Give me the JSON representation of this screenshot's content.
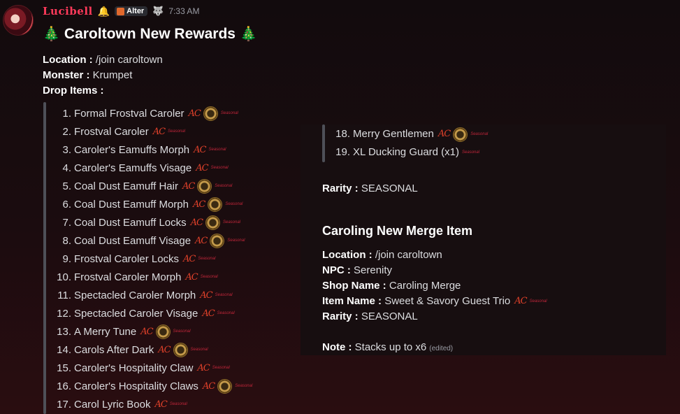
{
  "message": {
    "username": "Lucibell",
    "tag_label": "Alter",
    "timestamp": "7:33 AM",
    "title": "Caroltown New Rewards",
    "fields": [
      {
        "label": "Location :",
        "value": " /join caroltown"
      },
      {
        "label": "Monster :",
        "value": " Krumpet"
      },
      {
        "label": "Drop Items :",
        "value": ""
      }
    ],
    "drop_items": [
      {
        "num": "1.",
        "name": "Formal Frostval Caroler",
        "ac": "AC",
        "coin": true,
        "badge": "Seasonal"
      },
      {
        "num": "2.",
        "name": "Frostval Caroler",
        "ac": "AC",
        "coin": false,
        "badge": "Seasonal"
      },
      {
        "num": "3.",
        "name": "Caroler's Eamuffs Morph",
        "ac": "AC",
        "coin": false,
        "badge": "Seasonal"
      },
      {
        "num": "4.",
        "name": "Caroler's Eamuffs Visage",
        "ac": "AC",
        "coin": false,
        "badge": "Seasonal"
      },
      {
        "num": "5.",
        "name": "Coal Dust Eamuff Hair",
        "ac": "AC",
        "coin": true,
        "badge": "Seasonal"
      },
      {
        "num": "6.",
        "name": "Coal Dust Eamuff Morph",
        "ac": "AC",
        "coin": true,
        "badge": "Seasonal"
      },
      {
        "num": "7.",
        "name": "Coal Dust Eamuff Locks",
        "ac": "AC",
        "coin": true,
        "badge": "Seasonal"
      },
      {
        "num": "8.",
        "name": "Coal Dust Eamuff Visage",
        "ac": "AC",
        "coin": true,
        "badge": "Seasonal"
      },
      {
        "num": "9.",
        "name": "Frostval Caroler Locks",
        "ac": "AC",
        "coin": false,
        "badge": "Seasonal"
      },
      {
        "num": "10.",
        "name": "Frostval Caroler Morph",
        "ac": "AC",
        "coin": false,
        "badge": "Seasonal"
      },
      {
        "num": "11.",
        "name": "Spectacled Caroler Morph",
        "ac": "AC",
        "coin": false,
        "badge": "Seasonal"
      },
      {
        "num": "12.",
        "name": "Spectacled Caroler Visage",
        "ac": "AC",
        "coin": false,
        "badge": "Seasonal"
      },
      {
        "num": "13.",
        "name": "A Merry Tune",
        "ac": "AC",
        "coin": true,
        "badge": "Seasonal"
      },
      {
        "num": "14.",
        "name": "Carols After Dark",
        "ac": "AC",
        "coin": true,
        "badge": "Seasonal"
      },
      {
        "num": "15.",
        "name": "Caroler's Hospitality Claw",
        "ac": "AC",
        "coin": false,
        "badge": "Seasonal"
      },
      {
        "num": "16.",
        "name": "Caroler's Hospitality Claws",
        "ac": "AC",
        "coin": true,
        "badge": "Seasonal"
      },
      {
        "num": "17.",
        "name": "Carol Lyric Book",
        "ac": "AC",
        "coin": false,
        "badge": "Seasonal"
      }
    ]
  },
  "continued": {
    "items": [
      {
        "num": "18.",
        "name": "Merry Gentlemen",
        "ac": "AC",
        "coin": true,
        "badge": "Seasonal"
      },
      {
        "num": "19.",
        "name": "XL Ducking Guard (x1)",
        "ac": "",
        "coin": false,
        "badge": "Seasonal"
      }
    ],
    "rarity_label": "Rarity :",
    "rarity_value": " SEASONAL",
    "merge_title": "Caroling New Merge Item",
    "merge_fields": [
      {
        "label": "Location :",
        "value": " /join caroltown"
      },
      {
        "label": "NPC :",
        "value": " Serenity"
      },
      {
        "label": "Shop Name :",
        "value": " Caroling Merge"
      },
      {
        "label": "Item Name :",
        "value": " Sweet & Savory Guest Trio"
      },
      {
        "label": "Rarity :",
        "value": " SEASONAL"
      }
    ],
    "merge_item_ac": "AC",
    "merge_item_badge": "Seasonal",
    "note_label": "Note :",
    "note_value": " Stacks up to x6",
    "edited": "(edited)"
  },
  "icons": {
    "bell": "bell-icon",
    "tree": "christmas-tree-icon",
    "wolf": "wolf-icon",
    "coin": "gold-coin-icon"
  },
  "colors": {
    "username": "#ff3a5a",
    "ac_mark": "#e0412a",
    "seasonal_badge": "#c0263a",
    "quote_bar": "#4e5058"
  }
}
